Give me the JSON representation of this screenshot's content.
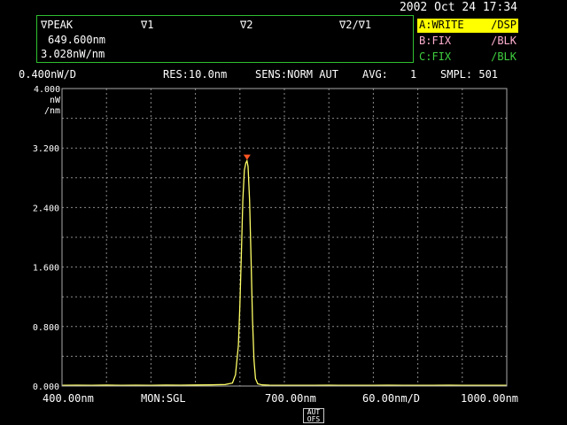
{
  "datetime": "2002 Oct 24 17:34",
  "markers": {
    "h_vpeak": "∇PEAK",
    "h_v1": "∇1",
    "h_v2": "∇2",
    "h_v2v1": "∇2/∇1",
    "peak_wl": "649.600nm",
    "peak_lvl": "3.028nW/nm"
  },
  "traces": {
    "a_left": "A:WRITE",
    "a_right": "/DSP",
    "b_left": "B:FIX",
    "b_right": "/BLK",
    "c_left": "C:FIX",
    "c_right": "/BLK"
  },
  "settings": {
    "scale": "0.400nW/D",
    "res": "RES:10.0nm",
    "sens": "SENS:NORM AUT",
    "avg_label": "AVG:",
    "avg_value": "1",
    "smpl": "SMPL: 501"
  },
  "y_unit": [
    "4.000",
    "nW",
    "/nm"
  ],
  "bottom": {
    "start": "400.00nm",
    "mon": "MON:SGL",
    "center": "700.00nm",
    "span": "60.00nm/D",
    "stop": "1000.00nm"
  },
  "aut_button": [
    "AUT",
    "OFS"
  ],
  "colors": {
    "trace": "#ffff66",
    "grid": "#8a8a8a",
    "marker": "#ff5522",
    "panel_border": "#2fbf2f",
    "active_bg": "#ffff00"
  },
  "chart_data": {
    "type": "line",
    "xlim": [
      400,
      1000
    ],
    "ylim": [
      0,
      4.0
    ],
    "x_unit": "nm",
    "y_unit": "nW/nm",
    "y_ticks": [
      "0.000",
      "0.800",
      "1.600",
      "2.400",
      "3.200",
      "4.000"
    ],
    "grid": true,
    "peak": {
      "x": 649.6,
      "y": 3.028
    },
    "series": [
      {
        "x": [
          400,
          420,
          440,
          460,
          480,
          500,
          520,
          540,
          560,
          580,
          600,
          620,
          630,
          634,
          638,
          640,
          642,
          644,
          646,
          648,
          649.6,
          651,
          653,
          655,
          657,
          659,
          661,
          664,
          670,
          680,
          700,
          720,
          740,
          760,
          780,
          800,
          820,
          840,
          860,
          880,
          900,
          920,
          940,
          960,
          980,
          1000
        ],
        "y": [
          0.01,
          0.012,
          0.01,
          0.013,
          0.01,
          0.012,
          0.01,
          0.013,
          0.012,
          0.014,
          0.015,
          0.02,
          0.04,
          0.15,
          0.55,
          1.1,
          1.8,
          2.5,
          2.9,
          3.0,
          3.028,
          2.95,
          2.5,
          1.7,
          0.9,
          0.35,
          0.1,
          0.03,
          0.015,
          0.012,
          0.01,
          0.011,
          0.01,
          0.012,
          0.01,
          0.011,
          0.01,
          0.012,
          0.01,
          0.011,
          0.01,
          0.012,
          0.01,
          0.011,
          0.01,
          0.01
        ]
      }
    ]
  }
}
